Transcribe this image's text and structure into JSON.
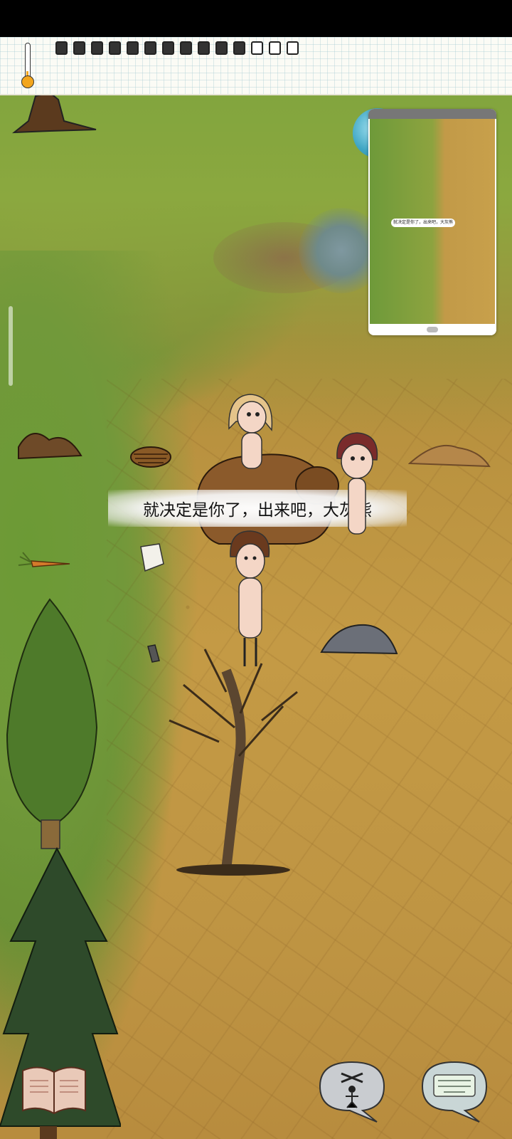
{
  "status_bar": {},
  "hud": {
    "thermometer": {
      "icon": "thermometer-icon",
      "level": 0.3
    },
    "food_meter": {
      "full_pips": 11,
      "empty_pips": 3
    }
  },
  "speech": {
    "text": "就决定是你了，出来吧，大灰熊"
  },
  "minimap": {
    "speech_text": "就决定是你了，出来吧，大灰熊"
  },
  "controls": {
    "recipe_book": "book-icon",
    "emote": "puppet-icon",
    "keyboard": "keyboard-icon"
  },
  "colors": {
    "grass": "#6f9a38",
    "dirt": "#c49a45",
    "paper": "#fbfbf5"
  }
}
